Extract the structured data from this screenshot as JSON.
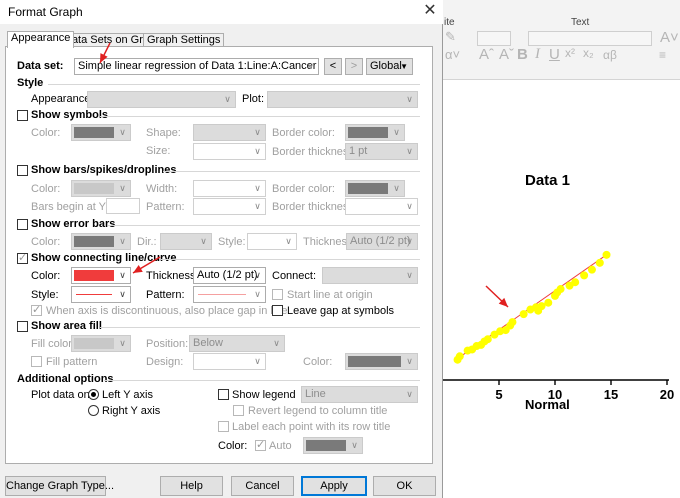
{
  "dialog": {
    "title": "Format Graph",
    "tabs": [
      {
        "label": "Appearance",
        "active": true
      },
      {
        "label": "Data Sets on Graph",
        "active": false
      },
      {
        "label": "Graph Settings",
        "active": false
      }
    ],
    "dataset": {
      "label": "Data set:",
      "value": "Simple linear regression of Data 1:Line:A:Cancer",
      "prev": "<",
      "next": ">",
      "scope": "Global"
    },
    "style": {
      "header": "Style",
      "appearance_label": "Appearance:",
      "plot_label": "Plot:"
    },
    "symbols": {
      "header": "Show symbols",
      "checked": false,
      "color_label": "Color:",
      "shape_label": "Shape:",
      "size_label": "Size:",
      "border_color_label": "Border color:",
      "border_thickness_label": "Border thickness:",
      "border_thickness_value": "1 pt"
    },
    "bars": {
      "header": "Show bars/spikes/droplines",
      "checked": false,
      "color_label": "Color:",
      "width_label": "Width:",
      "begin_label": "Bars begin at Y =",
      "pattern_label": "Pattern:",
      "border_color_label": "Border color:",
      "border_thickness_label": "Border thickness:"
    },
    "error_bars": {
      "header": "Show error bars",
      "checked": false,
      "color_label": "Color:",
      "dir_label": "Dir.:",
      "style_label": "Style:",
      "thickness_label": "Thickness:",
      "thickness_value": "Auto (1/2 pt)"
    },
    "connecting": {
      "header": "Show connecting line/curve",
      "checked": true,
      "color_label": "Color:",
      "color": "#f03c3c",
      "thickness_label": "Thickness:",
      "thickness_value": "Auto (1/2 pt)",
      "connect_label": "Connect:",
      "style_label": "Style:",
      "pattern_label": "Pattern:",
      "start_origin_label": "Start line at origin",
      "discontinuous_label": "When axis is discontinuous, also place gap in line",
      "leave_gap_label": "Leave gap at symbols"
    },
    "area_fill": {
      "header": "Show area fill",
      "checked": false,
      "fill_color_label": "Fill color:",
      "position_label": "Position:",
      "position_value": "Below",
      "fill_pattern_label": "Fill pattern",
      "design_label": "Design:",
      "color_label": "Color:"
    },
    "additional": {
      "header": "Additional options",
      "plot_data_on_label": "Plot data on:",
      "left_axis_label": "Left Y axis",
      "right_axis_label": "Right  Y axis",
      "show_legend_label": "Show legend",
      "legend_value": "Line",
      "revert_legend_label": "Revert legend to column title",
      "label_point_label": "Label each point with its row title",
      "color_label": "Color:",
      "auto_label": "Auto"
    },
    "buttons": {
      "change_graph": "Change Graph Type...",
      "help": "Help",
      "cancel": "Cancel",
      "apply": "Apply",
      "ok": "OK"
    }
  },
  "background": {
    "ribbon": {
      "group_label_left": "ite",
      "group_label_text": "Text"
    },
    "chart_data": {
      "type": "scatter",
      "title": "Data 1",
      "xlabel": "Normal",
      "ylabel": "",
      "xlim": [
        0,
        20
      ],
      "xticks": [
        "5",
        "10",
        "15",
        "20"
      ],
      "points_x": [
        1.3,
        1.5,
        2.2,
        2.6,
        3.0,
        3.4,
        3.7,
        4.0,
        4.6,
        5.1,
        5.6,
        6.0,
        6.2,
        7.2,
        7.8,
        8.3,
        8.5,
        8.8,
        9.4,
        10.0,
        10.2,
        10.5,
        11.3,
        11.8,
        12.6,
        13.3,
        14.0,
        14.6
      ],
      "points_level": [
        0.02,
        0.05,
        0.1,
        0.11,
        0.14,
        0.15,
        0.18,
        0.2,
        0.24,
        0.27,
        0.28,
        0.32,
        0.35,
        0.42,
        0.46,
        0.48,
        0.45,
        0.49,
        0.52,
        0.58,
        0.61,
        0.64,
        0.67,
        0.7,
        0.76,
        0.81,
        0.87,
        0.94
      ],
      "point_color": "#ffff00",
      "line_color": "#f03c3c"
    }
  },
  "colors": {
    "annotation_arrow": "#e02020"
  }
}
